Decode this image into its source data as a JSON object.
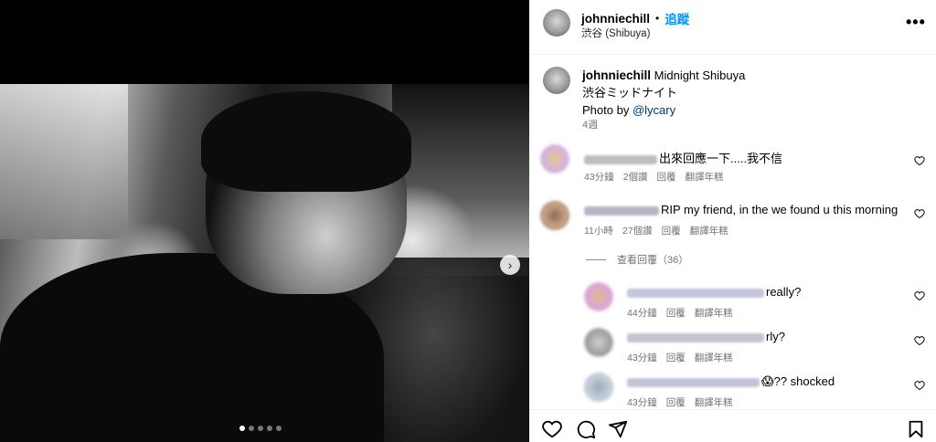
{
  "post": {
    "username": "johnniechill",
    "follow_label": "追蹤",
    "location": "渋谷 (Shibuya)",
    "more_icon": "more-horizontal-icon"
  },
  "caption": {
    "username": "johnniechill",
    "line1": "Midnight Shibuya",
    "line2": "渋谷ミッドナイト",
    "photo_by": "Photo by ",
    "photo_credit": "@lycary",
    "time": "4週"
  },
  "comments": [
    {
      "text": "出來回應一下.....我不信",
      "time": "43分鐘",
      "likes": "2個讚",
      "reply": "回覆",
      "translate": "翻譯年糕"
    },
    {
      "text": "RIP my friend, in the we found u this morning",
      "time": "11小時",
      "likes": "27個讚",
      "reply": "回覆",
      "translate": "翻譯年糕"
    }
  ],
  "view_replies": "查看回覆（36）",
  "replies": [
    {
      "text": "really?",
      "time": "44分鐘",
      "reply": "回覆",
      "translate": "翻譯年糕"
    },
    {
      "text": "rly?",
      "time": "43分鐘",
      "reply": "回覆",
      "translate": "翻譯年糕"
    },
    {
      "text": "😱?? shocked",
      "time": "43分鐘",
      "reply": "回覆",
      "translate": "翻譯年糕"
    }
  ],
  "media": {
    "slides_total": 5,
    "active_slide": 1,
    "next_icon": "chevron-right-icon"
  },
  "colors": {
    "follow": "#0095f6",
    "link": "#00376b",
    "meta": "#737373"
  }
}
